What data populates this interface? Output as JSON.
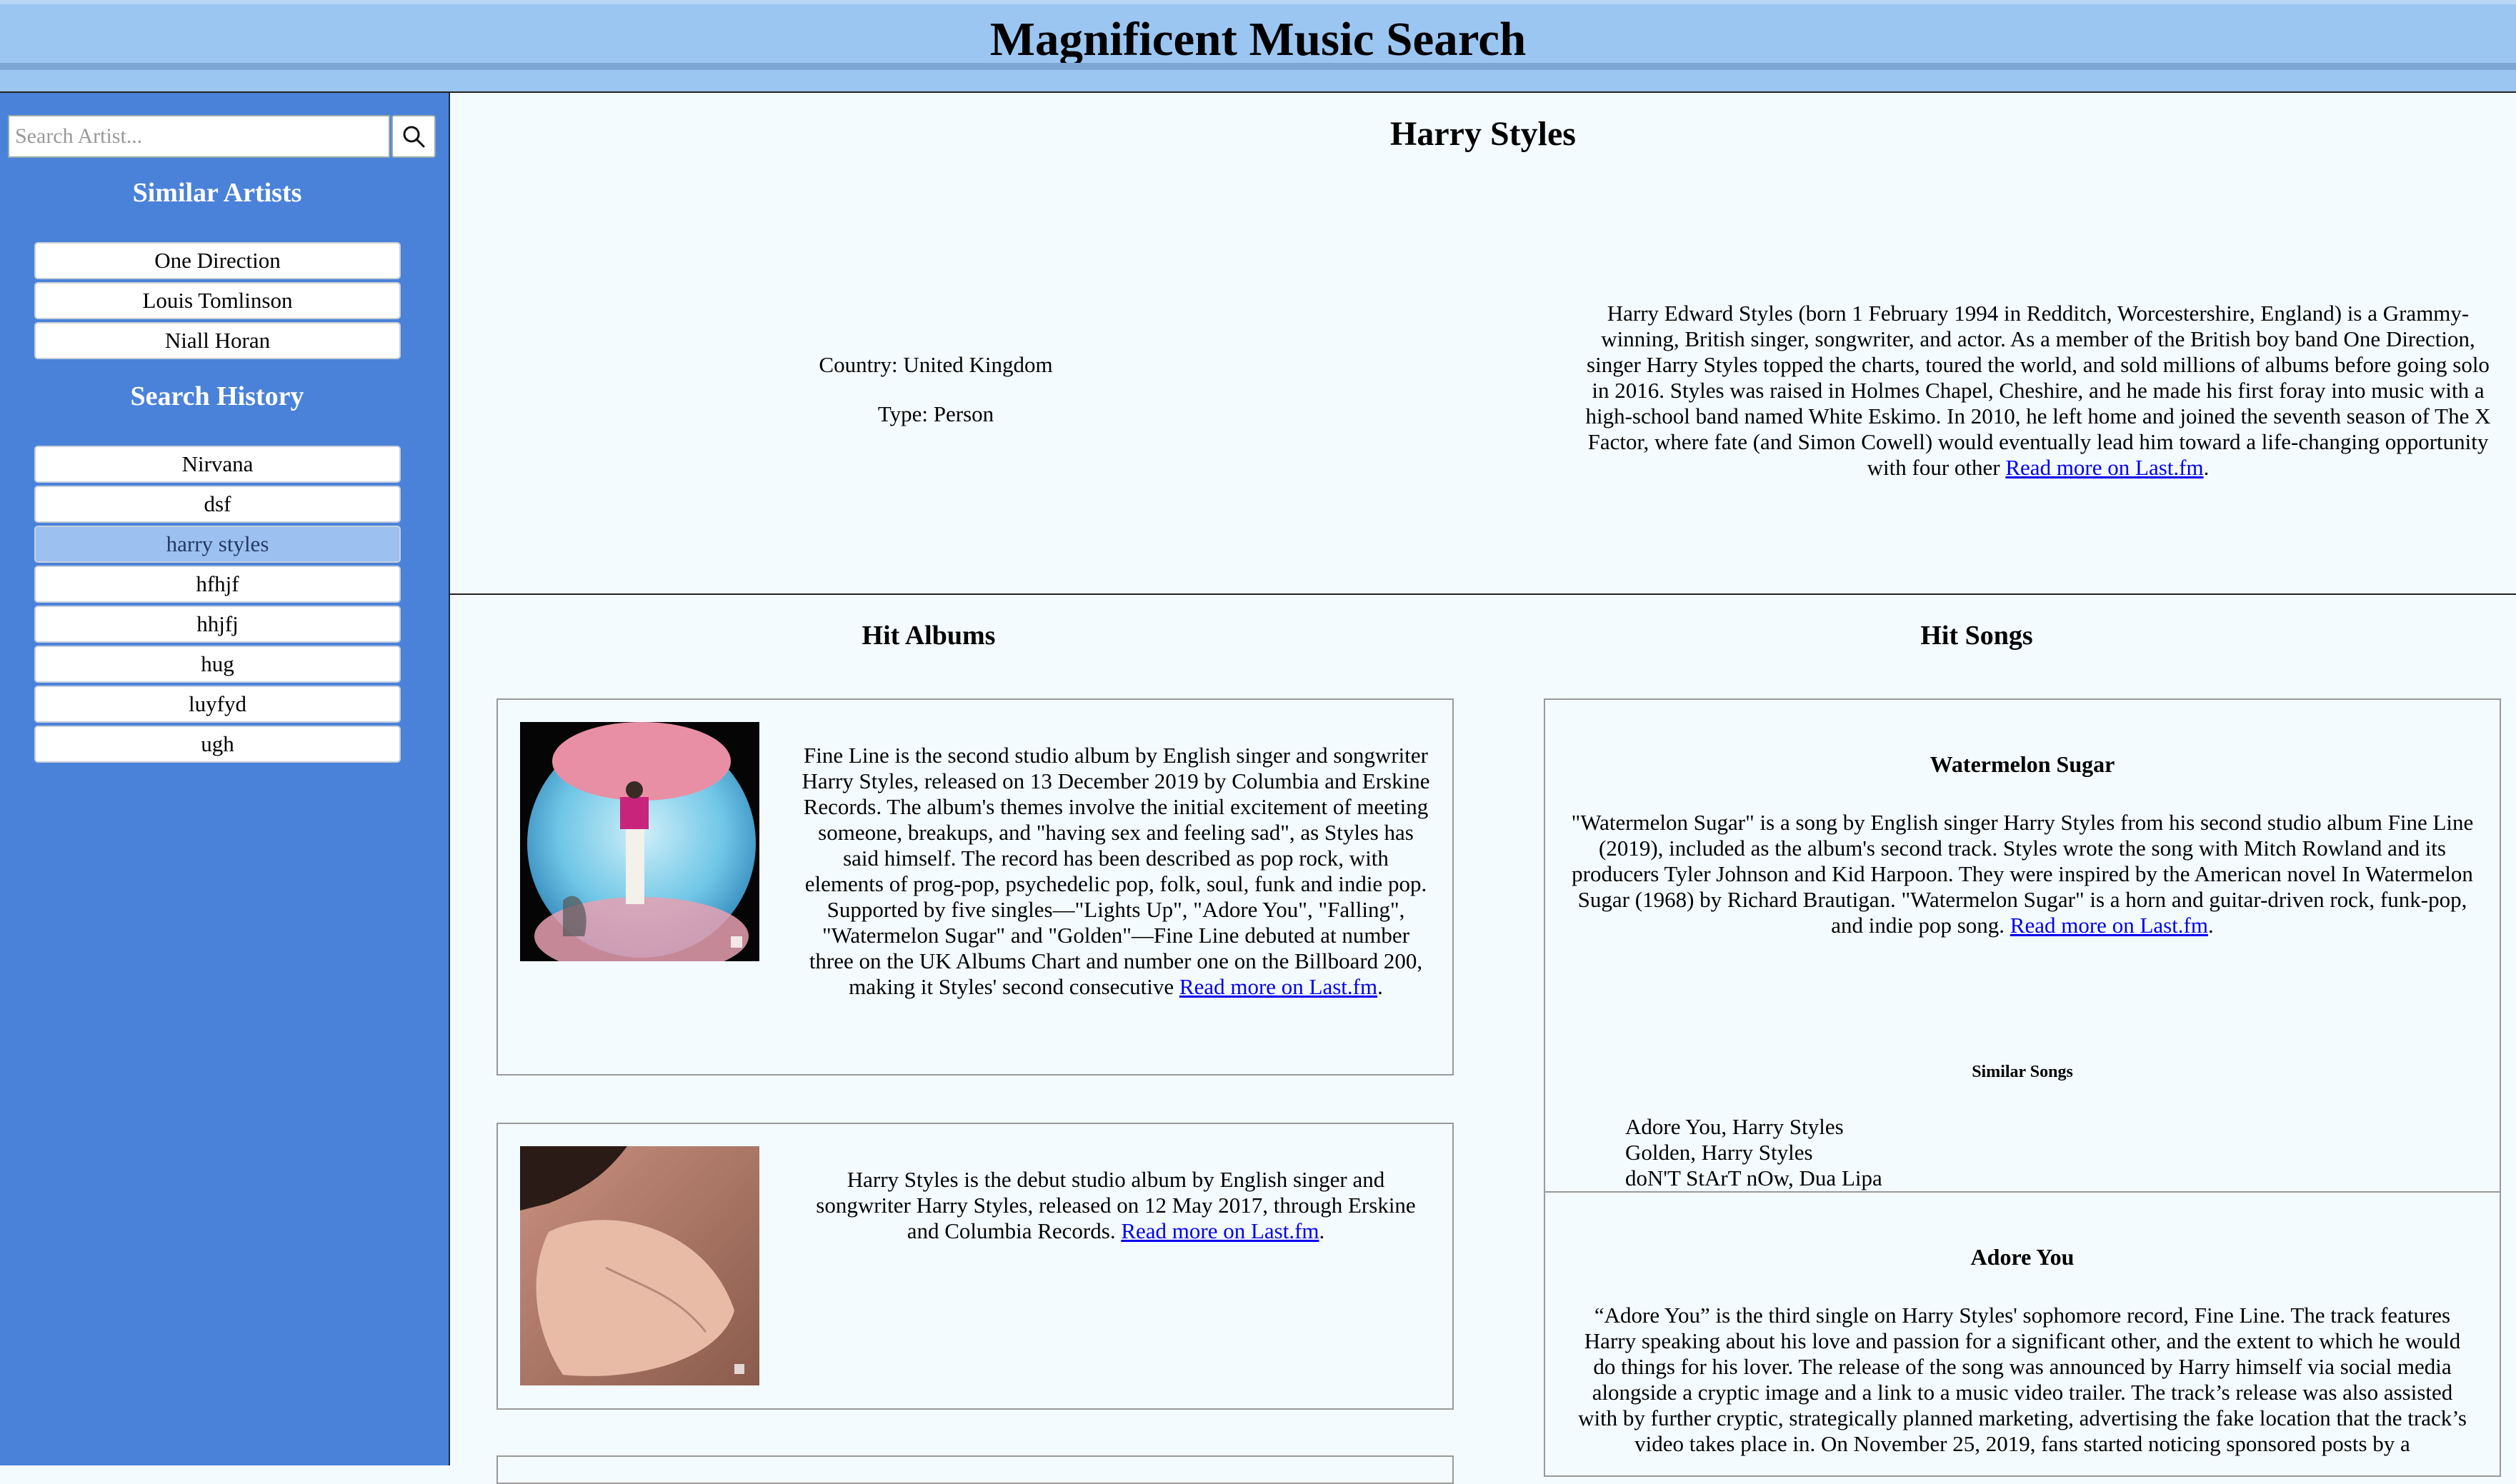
{
  "header": {
    "title": "Magnificent Music Search"
  },
  "sidebar": {
    "search": {
      "placeholder": "Search Artist..."
    },
    "similar_heading": "Similar Artists",
    "similar_artists": [
      "One Direction",
      "Louis Tomlinson",
      "Niall Horan"
    ],
    "history_heading": "Search History",
    "history": [
      "Nirvana",
      "dsf",
      "harry styles",
      "hfhjf",
      "hhjfj",
      "hug",
      "luyfyd",
      "ugh"
    ],
    "active_history": "harry styles"
  },
  "artist": {
    "name": "Harry Styles",
    "country": "Country: United Kingdom",
    "type": "Type: Person",
    "bio": "Harry Edward Styles (born 1 February 1994 in Redditch, Worcestershire, England) is a Grammy-winning, British singer, songwriter, and actor. As a member of the British boy band One Direction, singer Harry Styles topped the charts, toured the world, and sold millions of albums before going solo in 2016. Styles was raised in Holmes Chapel, Cheshire, and he made his first foray into music with a high-school band named White Eskimo. In 2010, he left home and joined the seventh season of The X Factor, where fate (and Simon Cowell) would eventually lead him toward a life-changing opportunity with four other ",
    "bio_link": "Read more on Last.fm"
  },
  "albums": {
    "heading": "Hit Albums",
    "items": [
      {
        "text": "Fine Line is the second studio album by English singer and songwriter Harry Styles, released on 13 December 2019 by Columbia and Erskine Records. The album's themes involve the initial excitement of meeting someone, breakups, and \"having sex and feeling sad\", as Styles has said himself. The record has been described as pop rock, with elements of prog-pop, psychedelic pop, folk, soul, funk and indie pop. Supported by five singles—\"Lights Up\", \"Adore You\", \"Falling\", \"Watermelon Sugar\" and \"Golden\"—Fine Line debuted at number three on the UK Albums Chart and number one on the Billboard 200, making it Styles' second consecutive ",
        "link": "Read more on Last.fm"
      },
      {
        "text": "Harry Styles is the debut studio album by English singer and songwriter Harry Styles, released on 12 May 2017, through Erskine and Columbia Records. ",
        "link": "Read more on Last.fm"
      }
    ]
  },
  "songs": {
    "heading": "Hit Songs",
    "items": [
      {
        "title": "Watermelon Sugar",
        "text": "\"Watermelon Sugar\" is a song by English singer Harry Styles from his second studio album Fine Line (2019), included as the album's second track. Styles wrote the song with Mitch Rowland and its producers Tyler Johnson and Kid Harpoon. They were inspired by the American novel In Watermelon Sugar (1968) by Richard Brautigan. \"Watermelon Sugar\" is a horn and guitar-driven rock, funk-pop, and indie pop song. ",
        "link": "Read more on Last.fm",
        "similar_heading": "Similar Songs",
        "similar": [
          "Adore You, Harry Styles",
          "Golden, Harry Styles",
          "doN'T StArT nOw, Dua Lipa"
        ]
      },
      {
        "title": "Adore You",
        "text": "“Adore You” is the third single on Harry Styles' sophomore record, Fine Line. The track features Harry speaking about his love and passion for a significant other, and the extent to which he would do things for his lover. The release of the song was announced by Harry himself via social media alongside a cryptic image and a link to a music video trailer. The track’s release was also assisted with by further cryptic, strategically planned marketing, advertising the fake location that the track’s video takes place in. On November 25, 2019, fans started noticing sponsored posts by a"
      }
    ]
  },
  "colors": {
    "header_bg": "#9cc6f2",
    "sidebar_bg": "#4a82d9",
    "active_item": "#9cc0ef",
    "link": "#0000ee"
  }
}
